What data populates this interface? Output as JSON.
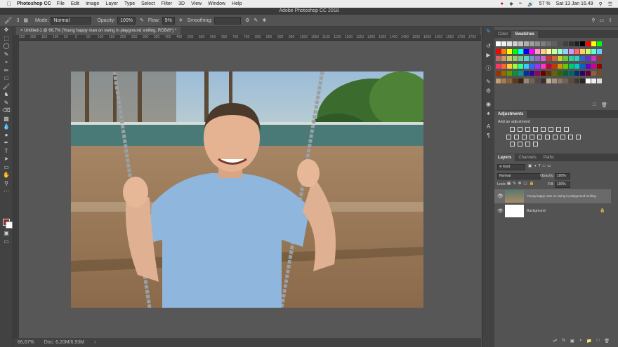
{
  "menubar": {
    "app": "Photoshop CC",
    "items": [
      "File",
      "Edit",
      "Image",
      "Layer",
      "Type",
      "Select",
      "Filter",
      "3D",
      "View",
      "Window",
      "Help"
    ],
    "battery": "57 %",
    "clock": "Sat 13 Jan  16.49"
  },
  "window": {
    "title": "Adobe Photoshop CC 2018"
  },
  "options": {
    "mode_label": "Mode:",
    "mode_value": "Normal",
    "opacity_label": "Opacity:",
    "opacity_value": "100%",
    "flow_label": "Flow:",
    "flow_value": "5%",
    "smoothing_label": "Smoothing:",
    "brush_size": "3"
  },
  "document": {
    "tab_title": "Untitled-1 @ 66,7% (Young happy man on swing in playground smiling, RGB/8*) *",
    "ruler_ticks": [
      "250",
      "200",
      "150",
      "100",
      "50",
      "0",
      "50",
      "100",
      "150",
      "200",
      "250",
      "300",
      "350",
      "400",
      "450",
      "500",
      "550",
      "600",
      "650",
      "700",
      "750",
      "800",
      "850",
      "900",
      "950",
      "1000",
      "1050",
      "1100",
      "1150",
      "1200",
      "1250",
      "1300",
      "1350",
      "1400",
      "1450",
      "1500",
      "1550",
      "1600",
      "1650",
      "1700",
      "1750"
    ]
  },
  "status": {
    "zoom": "66,67%",
    "doc": "Doc: 6,20M/6,93M"
  },
  "panels": {
    "color_tabs": [
      "Color",
      "Swatches"
    ],
    "adjustments_title": "Adjustments",
    "adjustments_hint": "Add an adjustment",
    "layers_tabs": [
      "Layers",
      "Channels",
      "Paths"
    ],
    "kind_label": "Kind",
    "blend_mode": "Normal",
    "opacity_label": "Opacity:",
    "opacity_value": "100%",
    "lock_label": "Lock:",
    "fill_label": "Fill:",
    "fill_value": "100%",
    "layers": [
      {
        "name": "Young happy man on swing in playground smiling",
        "selected": true
      },
      {
        "name": "Background",
        "selected": false,
        "locked": true
      }
    ]
  },
  "swatch_colors": [
    [
      "#ffffff",
      "#f0f0f0",
      "#e0e0e0",
      "#d0d0d0",
      "#c0c0c0",
      "#b0b0b0",
      "#a0a0a0",
      "#909090",
      "#808080",
      "#707070",
      "#606060",
      "#505050",
      "#404040",
      "#303030",
      "#202020",
      "#000000",
      "#ff0000",
      "#ffff00",
      "#00ff00"
    ],
    [
      "#ff0000",
      "#ff7f00",
      "#ffff00",
      "#00ff00",
      "#00ffff",
      "#0000ff",
      "#ff00ff",
      "#ff99cc",
      "#ffcc99",
      "#ffff99",
      "#ccff99",
      "#99ffcc",
      "#99ccff",
      "#cc99ff",
      "#ff6666",
      "#ffcc66",
      "#ccff66",
      "#66ffcc",
      "#66ccff"
    ],
    [
      "#cc6666",
      "#cc9966",
      "#cccc66",
      "#99cc66",
      "#66cc99",
      "#66cccc",
      "#6699cc",
      "#9966cc",
      "#cc66cc",
      "#cc3333",
      "#cc6633",
      "#cccc33",
      "#66cc33",
      "#33cc99",
      "#33cccc",
      "#3366cc",
      "#6633cc",
      "#cc33cc",
      "#993333"
    ],
    [
      "#ff3366",
      "#ff6633",
      "#ffcc33",
      "#99ff33",
      "#33ff99",
      "#33ccff",
      "#3366ff",
      "#9933ff",
      "#ff33cc",
      "#cc0033",
      "#cc3300",
      "#cc9900",
      "#66cc00",
      "#00cc66",
      "#00cccc",
      "#0066cc",
      "#6600cc",
      "#cc0099",
      "#990000"
    ],
    [
      "#993300",
      "#996600",
      "#669900",
      "#009933",
      "#009999",
      "#003399",
      "#330099",
      "#990066",
      "#660000",
      "#663300",
      "#666600",
      "#336600",
      "#006633",
      "#006666",
      "#003366",
      "#330066",
      "#660033",
      "#8c6239",
      "#754c24"
    ],
    [
      "#c69c6d",
      "#a67c52",
      "#8c6239",
      "#603913",
      "#42210b",
      "#998675",
      "#736357",
      "#534741",
      "#362f2d",
      "#c7b299",
      "#a8947d",
      "#8c7b68",
      "#736357",
      "#594a42",
      "#42372f",
      "#2b2420",
      "#ffffff",
      "#eeeeee",
      "#dddddd"
    ]
  ],
  "colors": {
    "accent": "#31a8ff",
    "panel": "#535353",
    "dark": "#424242"
  },
  "icons": [
    "apple-icon",
    "wifi-icon",
    "search-icon",
    "menu-icon",
    "brush-icon",
    "gear-icon",
    "eye-icon",
    "lock-icon",
    "fx-icon",
    "mask-icon",
    "folder-icon",
    "new-layer-icon",
    "trash-icon"
  ]
}
